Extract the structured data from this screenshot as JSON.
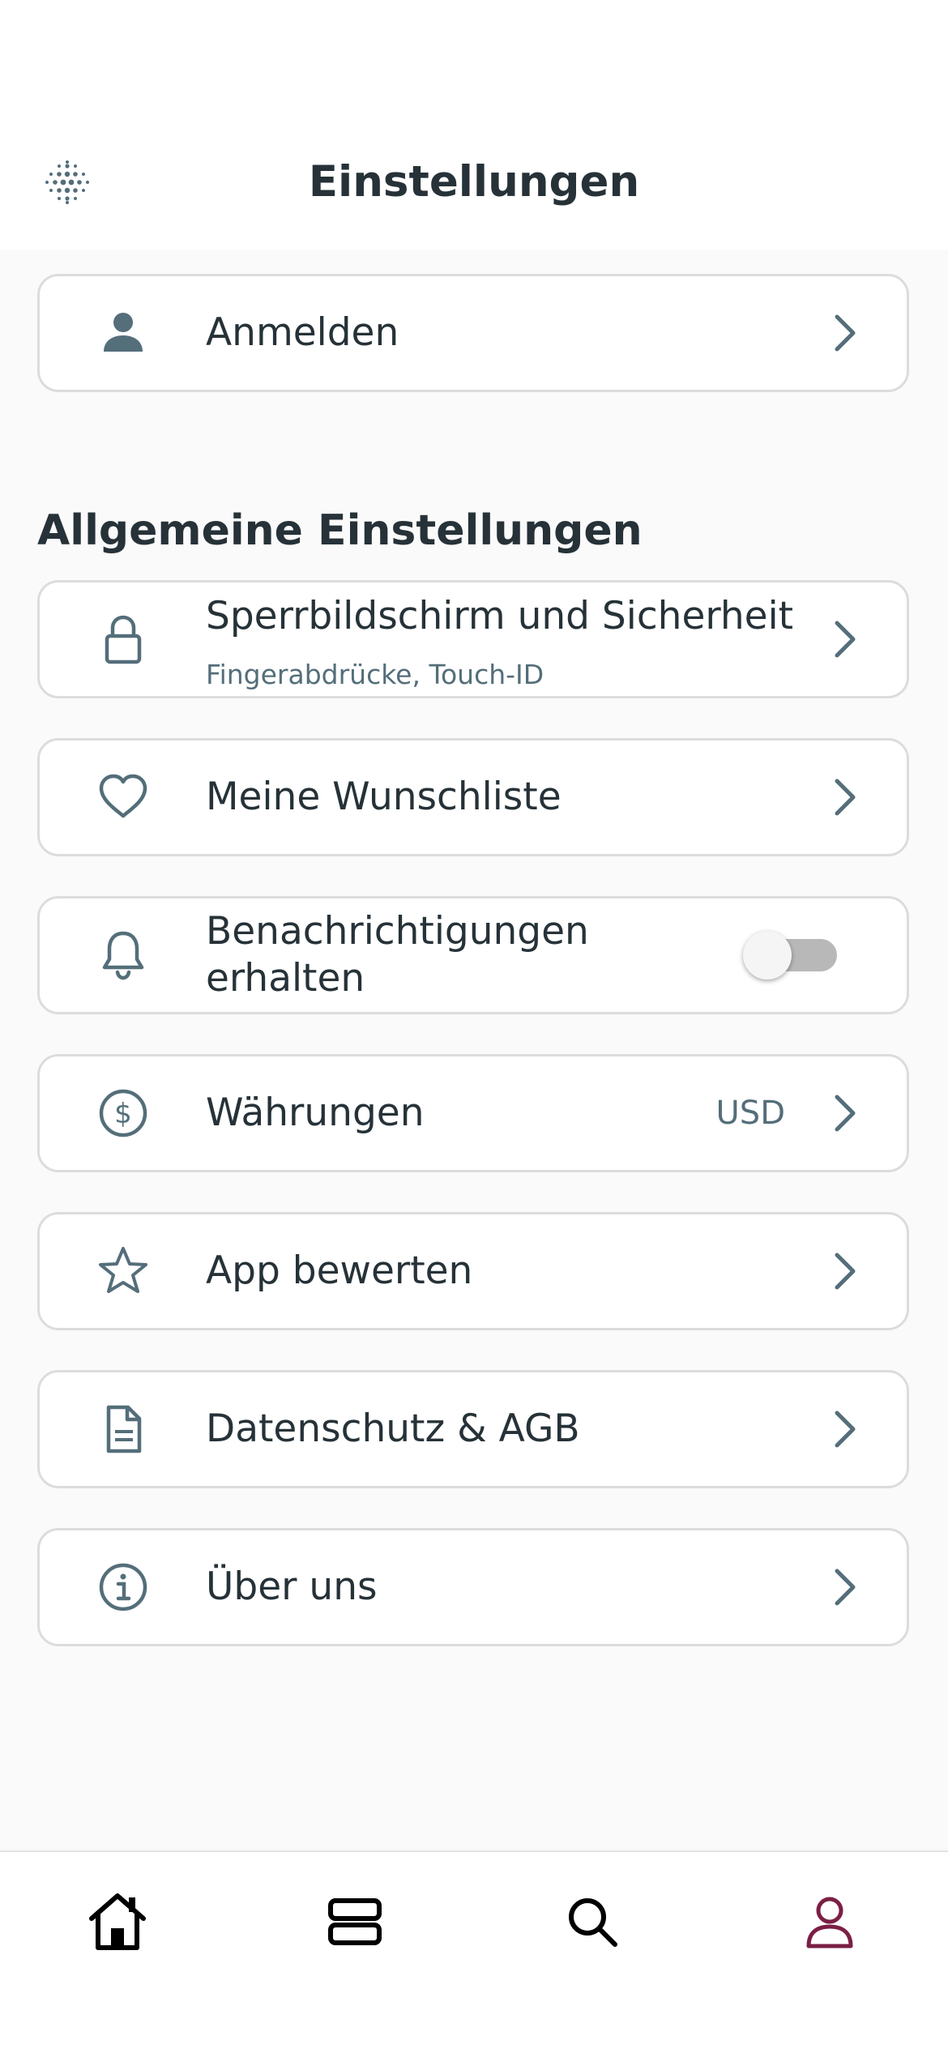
{
  "header": {
    "title": "Einstellungen",
    "logo_icon": "dotted-grid-logo-icon"
  },
  "login": {
    "label": "Anmelden",
    "icon": "person-icon"
  },
  "section": {
    "title": "Allgemeine Einstellungen"
  },
  "items": [
    {
      "label": "Sperrbildschirm und Sicherheit",
      "sub": "Fingerabdrücke, Touch-ID",
      "icon": "lock-icon"
    },
    {
      "label": "Meine Wunschliste",
      "icon": "heart-icon"
    },
    {
      "label": "Benachrichtigungen erhalten",
      "icon": "bell-icon",
      "toggle": false
    },
    {
      "label": "Währungen",
      "value": "USD",
      "icon": "dollar-circle-icon"
    },
    {
      "label": "App bewerten",
      "icon": "star-icon"
    },
    {
      "label": "Datenschutz & AGB",
      "icon": "document-icon"
    },
    {
      "label": "Über uns",
      "icon": "info-icon"
    }
  ],
  "tabbar": {
    "tabs": [
      {
        "name": "home",
        "icon": "home-icon"
      },
      {
        "name": "collections",
        "icon": "stack-icon"
      },
      {
        "name": "search",
        "icon": "search-icon"
      },
      {
        "name": "profile",
        "icon": "profile-icon",
        "active": true
      }
    ],
    "active_color": "#7b1f45",
    "icon_color": "#000000"
  },
  "colors": {
    "icon": "#546e7a",
    "text": "#263238",
    "border": "#dcdcdc",
    "background": "#fafafa"
  }
}
